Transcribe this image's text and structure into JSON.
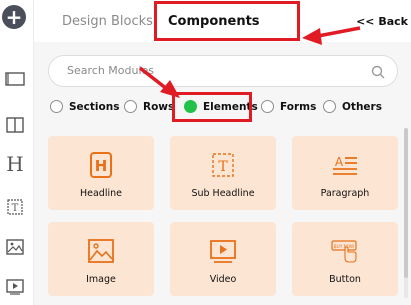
{
  "sidebar": {
    "add_glyph": "+",
    "items": [
      {
        "icon": "add-icon"
      },
      {
        "icon": "section-icon"
      },
      {
        "icon": "columns-icon"
      },
      {
        "icon": "heading-icon",
        "glyph": "H"
      },
      {
        "icon": "text-box-icon"
      },
      {
        "icon": "image-icon"
      },
      {
        "icon": "video-icon"
      }
    ]
  },
  "tabs": {
    "design_blocks": "Design Blocks",
    "components": "Components",
    "back": "<< Back"
  },
  "search": {
    "placeholder": "Search Modules"
  },
  "filters": [
    {
      "label": "Sections",
      "selected": false
    },
    {
      "label": "Rows",
      "selected": false
    },
    {
      "label": "Elements",
      "selected": true
    },
    {
      "label": "Forms",
      "selected": false
    },
    {
      "label": "Others",
      "selected": false
    }
  ],
  "elements": [
    {
      "label": "Headline",
      "icon": "headline-icon",
      "glyph": "H"
    },
    {
      "label": "Sub Headline",
      "icon": "sub-headline-icon",
      "glyph": "T"
    },
    {
      "label": "Paragraph",
      "icon": "paragraph-icon",
      "glyph": "A"
    },
    {
      "label": "Image",
      "icon": "image-icon"
    },
    {
      "label": "Video",
      "icon": "video-icon"
    },
    {
      "label": "Button",
      "icon": "button-icon",
      "glyph": "BUY NOW"
    }
  ],
  "colors": {
    "accent": "#e8711a",
    "card_bg": "#fde5d3",
    "selected_radio": "#22c24a",
    "annotation": "#e01b24"
  }
}
